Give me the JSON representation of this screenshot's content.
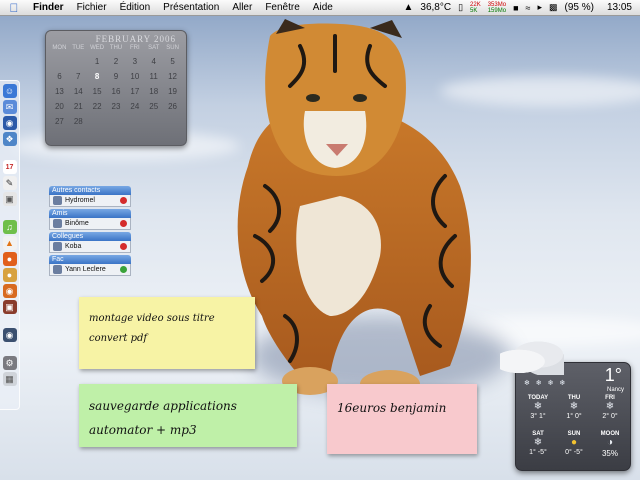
{
  "menubar": {
    "apple_icon": "apple-icon",
    "app_name": "Finder",
    "menus": [
      "Fichier",
      "Édition",
      "Présentation",
      "Aller",
      "Fenêtre",
      "Aide"
    ],
    "temperature": "36,8°C",
    "net_up": "22K",
    "net_down": "5K",
    "mem_used": "353Mo",
    "mem_free": "159Mo",
    "battery": "(95 %)",
    "clock": "13:05"
  },
  "calendar": {
    "month_label": "FEBRUARY 2006",
    "weekdays": [
      "MON",
      "TUE",
      "WED",
      "THU",
      "FRI",
      "SAT",
      "SUN"
    ],
    "days": [
      "",
      "",
      "1",
      "2",
      "3",
      "4",
      "5",
      "6",
      "7",
      "8",
      "9",
      "10",
      "11",
      "12",
      "13",
      "14",
      "15",
      "16",
      "17",
      "18",
      "19",
      "20",
      "21",
      "22",
      "23",
      "24",
      "25",
      "26",
      "27",
      "28",
      "",
      "",
      "",
      "",
      ""
    ],
    "today": "8"
  },
  "buddy_list": {
    "groups": [
      {
        "name": "Autres contacts",
        "buddies": [
          {
            "name": "Hydromel",
            "status_color": "#d42b2b"
          }
        ]
      },
      {
        "name": "Amis",
        "buddies": [
          {
            "name": "Binôme",
            "status_color": "#d42b2b"
          }
        ]
      },
      {
        "name": "Collegues",
        "buddies": [
          {
            "name": "Koba",
            "status_color": "#d42b2b"
          }
        ]
      },
      {
        "name": "Fac",
        "buddies": [
          {
            "name": "Yann Leclere",
            "status_color": "#3aa33a"
          }
        ]
      }
    ]
  },
  "stickies": {
    "yellow": [
      "montage video sous titre",
      "convert pdf"
    ],
    "green": [
      "sauvegarde applications",
      "automator + mp3"
    ],
    "pink": [
      "16euros benjamin"
    ]
  },
  "weather": {
    "current_temp": "1°",
    "city": "Nancy",
    "forecast": [
      {
        "day": "TODAY",
        "icon": "snow-icon",
        "temps": "3° 1°"
      },
      {
        "day": "THU",
        "icon": "snow-icon",
        "temps": "1° 0°"
      },
      {
        "day": "FRI",
        "icon": "snow-icon",
        "temps": "2° 0°"
      },
      {
        "day": "SAT",
        "icon": "snow-icon",
        "temps": "1° -5°"
      },
      {
        "day": "SUN",
        "icon": "sun-icon",
        "temps": "0° -5°"
      },
      {
        "day": "MOON",
        "icon": "moon-icon",
        "temps": "35%"
      }
    ]
  },
  "dock": {
    "icons": [
      "finder-icon",
      "mail-icon",
      "network-icon",
      "safari-icon",
      "ical-icon",
      "textedit-icon",
      "preview-icon",
      "itunes-icon",
      "vlc-icon",
      "firefox-icon",
      "camino-icon",
      "basketball-icon",
      "photo-icon",
      "gamepad-icon",
      "system-preferences-icon",
      "trash-icon"
    ]
  }
}
